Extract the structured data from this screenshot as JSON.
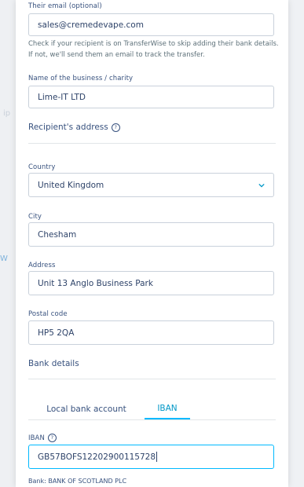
{
  "email": {
    "label": "Their email (optional)",
    "value": "sales@cremedevape.com",
    "help": "Check if your recipient is on TransferWise to skip adding their bank details. If not, we'll send them an email to track the transfer."
  },
  "business": {
    "label": "Name of the business / charity",
    "value": "Lime-IT LTD"
  },
  "address_section": {
    "title": "Recipient's address",
    "info_icon": "?"
  },
  "country": {
    "label": "Country",
    "value": "United Kingdom"
  },
  "city": {
    "label": "City",
    "value": "Chesham"
  },
  "address": {
    "label": "Address",
    "value": "Unit 13 Anglo Business Park"
  },
  "postal": {
    "label": "Postal code",
    "value": "HP5 2QA"
  },
  "bank_section": {
    "title": "Bank details"
  },
  "tabs": [
    {
      "label": "Local bank account"
    },
    {
      "label": "IBAN"
    }
  ],
  "iban": {
    "label": "IBAN",
    "info_icon": "?",
    "value": "GB57BOFS12202900115728"
  },
  "bank_name": "Bank: BANK OF SCOTLAND PLC",
  "colors": {
    "accent": "#00b9ff",
    "text": "#37517e",
    "border": "#c9d1db"
  }
}
